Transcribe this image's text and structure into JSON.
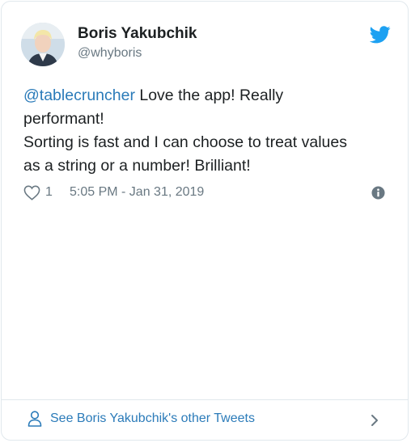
{
  "author": {
    "name": "Boris Yakubchik",
    "handle": "@whyboris"
  },
  "tweet": {
    "mention": "@tablecruncher",
    "line1_rest": " Love the app! Really",
    "line2": "performant!",
    "line3": "Sorting is fast and I can choose to treat values",
    "line4": "as a string or a number! Brilliant!"
  },
  "meta": {
    "like_count": "1",
    "timestamp": "5:05 PM - Jan 31, 2019"
  },
  "footer": {
    "link_label": "See Boris Yakubchik's other Tweets"
  },
  "colors": {
    "link": "#2b7bb9",
    "muted": "#697882",
    "text": "#1c2022",
    "twitter_blue": "#1da1f2",
    "border": "#e1e8ed"
  },
  "icons": {
    "brand": "twitter-bird-icon",
    "like": "heart-icon",
    "info": "info-icon",
    "profile": "person-icon",
    "navigate": "chevron-right-icon"
  }
}
